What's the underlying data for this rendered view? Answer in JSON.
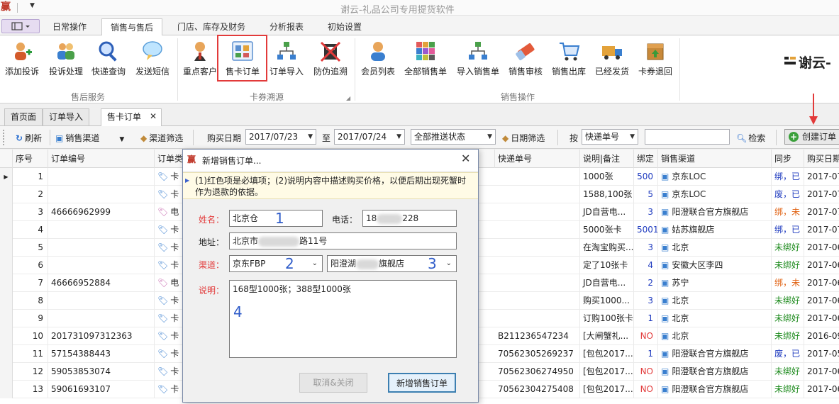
{
  "window": {
    "title": "谢云-礼品公司专用提货软件",
    "app_icon": "赢"
  },
  "ribbon_tabs": [
    "日常操作",
    "销售与售后",
    "门店、库存及财务",
    "分析报表",
    "初始设置"
  ],
  "ribbon": {
    "group_after_sales": {
      "label": "售后服务",
      "buttons": [
        "添加投诉",
        "投诉处理",
        "快递查询",
        "发送短信"
      ]
    },
    "group_card": {
      "label": "卡券溯源",
      "buttons": [
        "重点客户",
        "售卡订单",
        "订单导入",
        "防伪追溯"
      ]
    },
    "group_sales": {
      "label": "销售操作",
      "buttons": [
        "会员列表",
        "全部销售单",
        "导入销售单",
        "销售审核",
        "销售出库",
        "已经发货",
        "卡券退回"
      ]
    },
    "brand": "谢云-"
  },
  "doc_tabs": [
    "首页面",
    "订单导入",
    "售卡订单"
  ],
  "toolbar": {
    "refresh": "刷新",
    "channel": "销售渠道",
    "channel_filter": "渠道筛选",
    "buy_date": "购买日期",
    "date_from": "2017/07/23",
    "to": "至",
    "date_to": "2017/07/24",
    "push_status": "全部推送状态",
    "date_filter": "日期筛选",
    "by": "按",
    "search_field": "快递单号",
    "search_btn": "检索",
    "create_btn": "创建订单"
  },
  "grid": {
    "headers": [
      "序号",
      "订单编号",
      "订单类",
      "快递单号",
      "说明|备注",
      "绑定",
      "销售渠道",
      "同步",
      "购买日期"
    ],
    "rows": [
      {
        "seq": "1",
        "order": "",
        "type": "卡",
        "express": "",
        "note": "1000张",
        "bind": "500",
        "bind_color": "blue",
        "channel": "京东LOC",
        "sync": "绑，已",
        "sync_color": "blue",
        "date": "2017-07"
      },
      {
        "seq": "2",
        "order": "",
        "type": "卡",
        "express": "",
        "note": "1588,100张",
        "bind": "5",
        "bind_color": "blue",
        "channel": "京东LOC",
        "sync": "废，已",
        "sync_color": "blue",
        "date": "2017-07"
      },
      {
        "seq": "3",
        "order": "46666962999",
        "type": "电",
        "express": "",
        "note": "JD自营电...",
        "bind": "3",
        "bind_color": "blue",
        "channel": "阳澄联合官方旗舰店",
        "sync": "绑，未",
        "sync_color": "orange",
        "date": "2017-07"
      },
      {
        "seq": "4",
        "order": "",
        "type": "卡",
        "express": "",
        "note": "5000张卡",
        "bind": "5001",
        "bind_color": "blue",
        "channel": "姑苏旗舰店",
        "sync": "绑，已",
        "sync_color": "blue",
        "date": "2017-07"
      },
      {
        "seq": "5",
        "order": "",
        "type": "卡",
        "express": "",
        "note": "在淘宝购买...",
        "bind": "3",
        "bind_color": "blue",
        "channel": "北京",
        "sync": "未绑好",
        "sync_color": "green",
        "date": "2017-06"
      },
      {
        "seq": "6",
        "order": "",
        "type": "卡",
        "express": "",
        "note": "定了10张卡",
        "bind": "4",
        "bind_color": "blue",
        "channel": "安徽大区李四",
        "sync": "未绑好",
        "sync_color": "green",
        "date": "2017-06"
      },
      {
        "seq": "7",
        "order": "46666952884",
        "type": "电",
        "express": "",
        "note": "JD自营电...",
        "bind": "2",
        "bind_color": "blue",
        "channel": "苏宁",
        "sync": "绑，未",
        "sync_color": "orange",
        "date": "2017-06"
      },
      {
        "seq": "8",
        "order": "",
        "type": "卡",
        "express": "",
        "note": "购买1000...",
        "bind": "3",
        "bind_color": "blue",
        "channel": "北京",
        "sync": "未绑好",
        "sync_color": "green",
        "date": "2017-06"
      },
      {
        "seq": "9",
        "order": "",
        "type": "卡",
        "express": "",
        "note": "订购100张卡",
        "bind": "1",
        "bind_color": "blue",
        "channel": "北京",
        "sync": "未绑好",
        "sync_color": "green",
        "date": "2017-06"
      },
      {
        "seq": "10",
        "order": "201731097312363",
        "type": "卡",
        "express": "B211236547234",
        "note": "[大闸蟹礼...",
        "bind": "NO",
        "bind_color": "red",
        "channel": "北京",
        "sync": "未绑好",
        "sync_color": "green",
        "date": "2016-09"
      },
      {
        "seq": "11",
        "order": "57154388443",
        "type": "卡",
        "express": "70562305269237",
        "note": "[包包2017...",
        "bind": "1",
        "bind_color": "blue",
        "channel": "阳澄联合官方旗舰店",
        "sync": "废，已",
        "sync_color": "blue",
        "date": "2017-05"
      },
      {
        "seq": "12",
        "order": "59053853074",
        "type": "卡",
        "express": "70562306274950",
        "note": "[包包2017...",
        "bind": "NO",
        "bind_color": "red",
        "channel": "阳澄联合官方旗舰店",
        "sync": "未绑好",
        "sync_color": "green",
        "date": "2017-06"
      },
      {
        "seq": "13",
        "order": "59061693107",
        "type": "卡",
        "express": "70562304275408",
        "note": "[包包2017...",
        "bind": "NO",
        "bind_color": "red",
        "channel": "阳澄联合官方旗舰店",
        "sync": "未绑好",
        "sync_color": "green",
        "date": "2017-06"
      }
    ]
  },
  "dialog": {
    "title": "新增销售订单...",
    "note": "(1)红色项是必填项；(2)说明内容中描述购买价格，以便后期出现死蟹时作为退款的依据。",
    "name_label": "姓名：",
    "name_value": "北京仓",
    "phone_label": "电话：",
    "phone_value_start": "18",
    "phone_value_end": "228",
    "address_label": "地址：",
    "address_value_start": "北京市",
    "address_value_end": "路11号",
    "channel_label": "渠道：",
    "channel_value": "京东FBP",
    "shop_value_start": "阳澄湖",
    "shop_value_end": "旗舰店",
    "desc_label": "说明：",
    "desc_value": "168型1000张；388型1000张",
    "cancel_btn": "取消&关闭",
    "submit_btn": "新增销售订单",
    "annotations": [
      "1",
      "2",
      "3",
      "4"
    ]
  }
}
